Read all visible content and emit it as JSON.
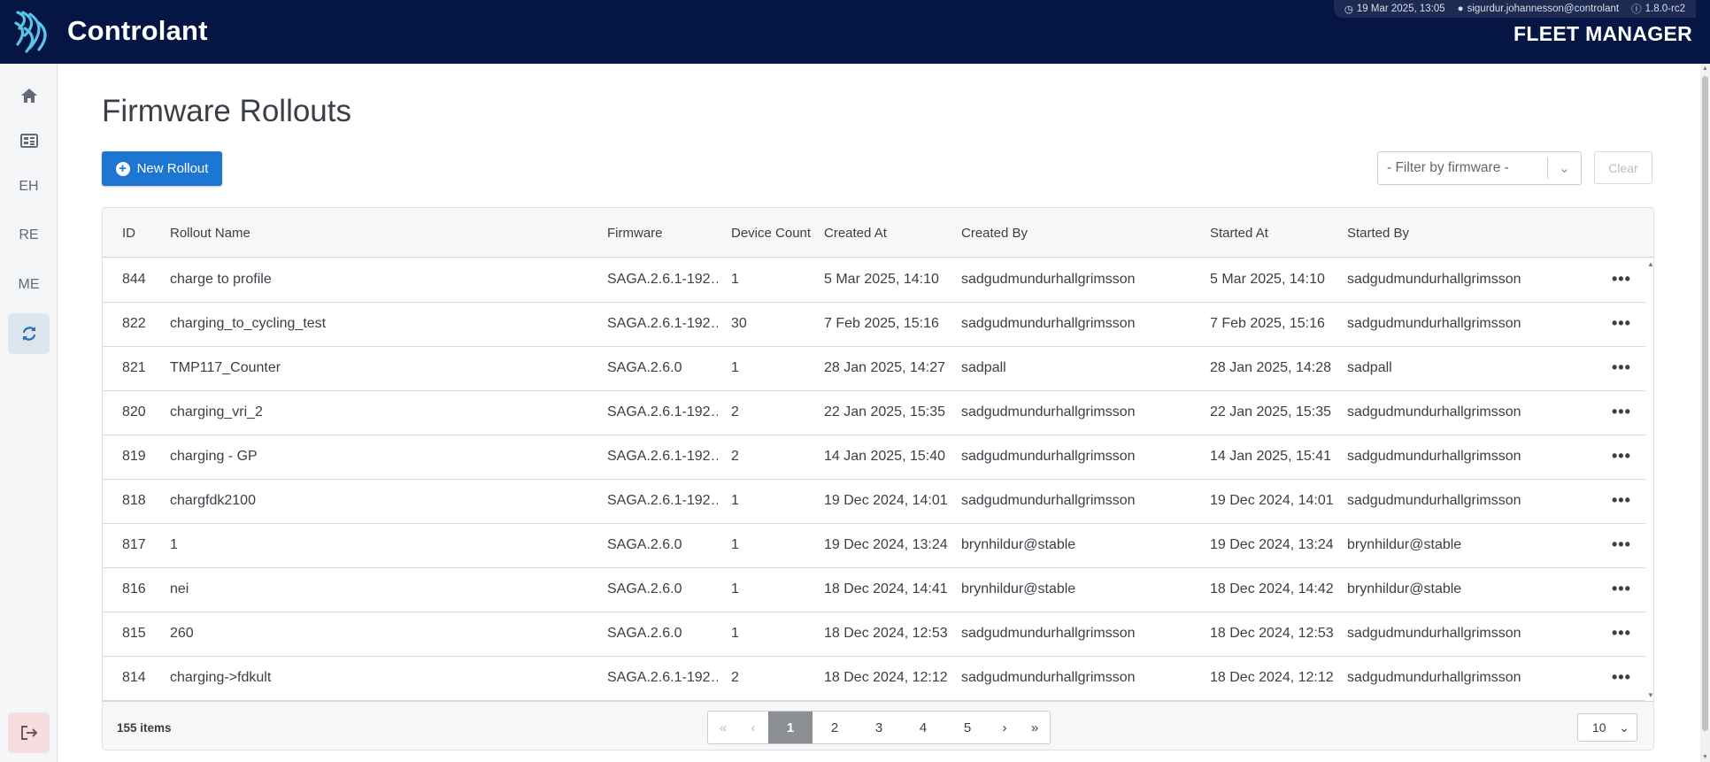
{
  "header": {
    "brand": "Controlant",
    "app_name": "FLEET MANAGER",
    "datetime": "19 Mar 2025, 13:05",
    "user": "sigurdur.johannesson@controlant",
    "version": "1.8.0-rc2",
    "brand_color": "#061644"
  },
  "sidebar": {
    "items": [
      {
        "icon": "home-icon",
        "label": ""
      },
      {
        "icon": "dashboard-icon",
        "label": ""
      },
      {
        "icon": "",
        "label": "EH"
      },
      {
        "icon": "",
        "label": "RE"
      },
      {
        "icon": "",
        "label": "ME"
      },
      {
        "icon": "sync-icon",
        "label": "",
        "active": true
      }
    ],
    "logout_icon": "logout-icon"
  },
  "page": {
    "title": "Firmware Rollouts",
    "new_button": "New Rollout",
    "filter_placeholder": "- Filter by firmware -",
    "clear_button": "Clear",
    "accent_color": "#1c76d2"
  },
  "table": {
    "columns": [
      "ID",
      "Rollout Name",
      "Firmware",
      "Device Count",
      "Created At",
      "Created By",
      "Started At",
      "Started By"
    ],
    "rows": [
      [
        "844",
        "charge to profile",
        "SAGA.2.6.1-192…",
        "1",
        "5 Mar 2025, 14:10",
        "sadgudmundurhallgrimsson",
        "5 Mar 2025, 14:10",
        "sadgudmundurhallgrimsson"
      ],
      [
        "822",
        "charging_to_cycling_test",
        "SAGA.2.6.1-192…",
        "30",
        "7 Feb 2025, 15:16",
        "sadgudmundurhallgrimsson",
        "7 Feb 2025, 15:16",
        "sadgudmundurhallgrimsson"
      ],
      [
        "821",
        "TMP117_Counter",
        "SAGA.2.6.0",
        "1",
        "28 Jan 2025, 14:27",
        "sadpall",
        "28 Jan 2025, 14:28",
        "sadpall"
      ],
      [
        "820",
        "charging_vri_2",
        "SAGA.2.6.1-192…",
        "2",
        "22 Jan 2025, 15:35",
        "sadgudmundurhallgrimsson",
        "22 Jan 2025, 15:35",
        "sadgudmundurhallgrimsson"
      ],
      [
        "819",
        "charging - GP",
        "SAGA.2.6.1-192…",
        "2",
        "14 Jan 2025, 15:40",
        "sadgudmundurhallgrimsson",
        "14 Jan 2025, 15:41",
        "sadgudmundurhallgrimsson"
      ],
      [
        "818",
        "chargfdk2100",
        "SAGA.2.6.1-192…",
        "1",
        "19 Dec 2024, 14:01",
        "sadgudmundurhallgrimsson",
        "19 Dec 2024, 14:01",
        "sadgudmundurhallgrimsson"
      ],
      [
        "817",
        "1",
        "SAGA.2.6.0",
        "1",
        "19 Dec 2024, 13:24",
        "brynhildur@stable",
        "19 Dec 2024, 13:24",
        "brynhildur@stable"
      ],
      [
        "816",
        "nei",
        "SAGA.2.6.0",
        "1",
        "18 Dec 2024, 14:41",
        "brynhildur@stable",
        "18 Dec 2024, 14:42",
        "brynhildur@stable"
      ],
      [
        "815",
        "260",
        "SAGA.2.6.0",
        "1",
        "18 Dec 2024, 12:53",
        "sadgudmundurhallgrimsson",
        "18 Dec 2024, 12:53",
        "sadgudmundurhallgrimsson"
      ],
      [
        "814",
        "charging->fdkult",
        "SAGA.2.6.1-192…",
        "2",
        "18 Dec 2024, 12:12",
        "sadgudmundurhallgrimsson",
        "18 Dec 2024, 12:12",
        "sadgudmundurhallgrimsson"
      ]
    ],
    "row_action_icon": "more-icon"
  },
  "footer": {
    "item_count": "155 items",
    "pages": [
      "1",
      "2",
      "3",
      "4",
      "5"
    ],
    "current_page": "1",
    "page_size": "10"
  }
}
